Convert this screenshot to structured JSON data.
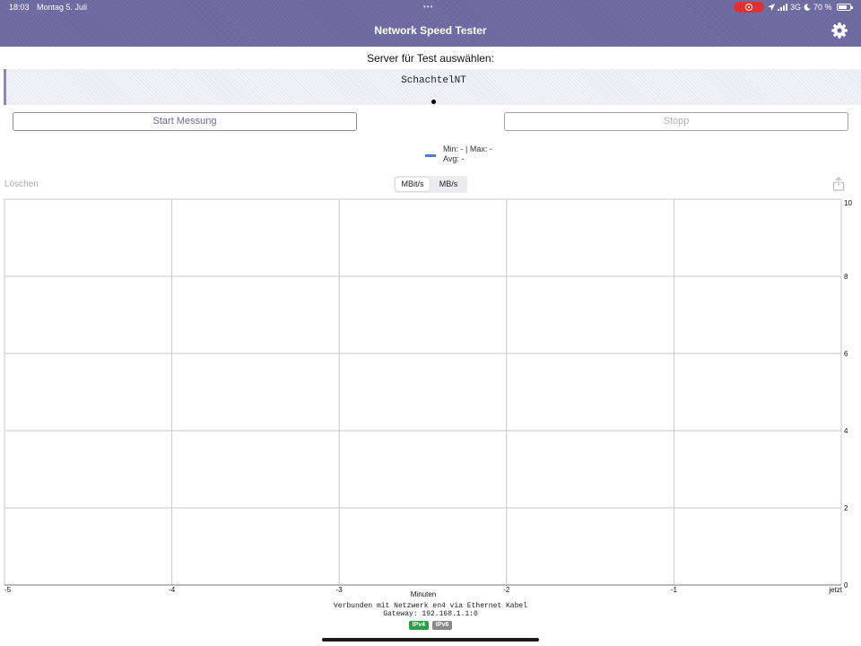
{
  "status_bar": {
    "time": "18:03",
    "date": "Montag 5. Juli",
    "network": "3G",
    "battery": "70 %"
  },
  "nav": {
    "title": "Network Speed Tester",
    "settings_icon": "gear-icon"
  },
  "server": {
    "label": "Server für Test auswählen:",
    "selected": "SchachtelNT"
  },
  "controls": {
    "start_label": "Start Messung",
    "stop_label": "Stopp",
    "clear_label": "Löschen"
  },
  "legend": {
    "line1": "Min: - | Max: -",
    "line2": "Avg: -",
    "color": "#4a7ed8"
  },
  "unit_toggle": {
    "options": [
      "MBit/s",
      "MB/s"
    ],
    "selected": "MBit/s"
  },
  "chart_data": {
    "type": "line",
    "title": "",
    "xlabel": "Minuten",
    "ylabel": "",
    "x_ticks": [
      "-5",
      "-4",
      "-3",
      "-2",
      "-1",
      "jetzt"
    ],
    "y_ticks": [
      "0",
      "2",
      "4",
      "6",
      "8",
      "10"
    ],
    "xlim": [
      -5,
      0
    ],
    "ylim": [
      0,
      10
    ],
    "grid": true,
    "series": []
  },
  "connection": {
    "line1": "Verbunden mit Netzwerk en4 via Ethernet Kabel",
    "line2": "Gateway: 192.168.1.1:0",
    "badges": [
      {
        "label": "IPv4",
        "color": "#27a046"
      },
      {
        "label": "IPv6",
        "color": "#8a8a8a"
      }
    ]
  },
  "colors": {
    "header": "#6a6aa0",
    "record": "#e03030"
  }
}
